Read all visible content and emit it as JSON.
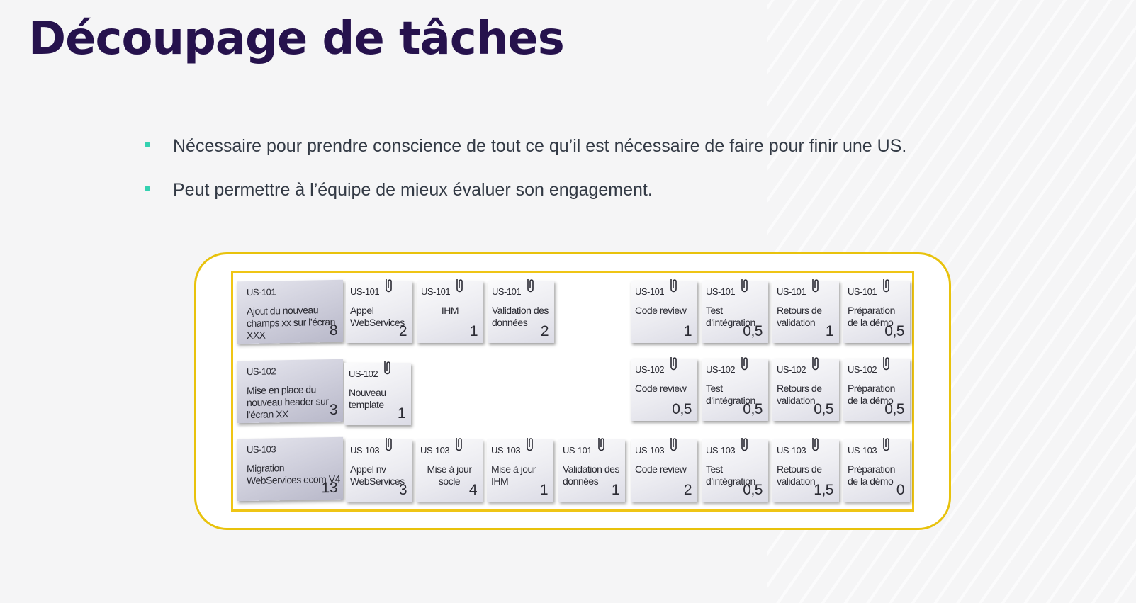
{
  "title": "Découpage de tâches",
  "bullets": [
    "Nécessaire pour prendre conscience de tout ce qu’il est nécessaire de  faire pour finir une US.",
    "Peut permettre à l’équipe de mieux évaluer son engagement."
  ],
  "board": {
    "rows": [
      {
        "story": {
          "id": "US-101",
          "text": "Ajout du nouveau champs xx sur l’écran XXX",
          "points": "8"
        },
        "tasks": [
          {
            "id": "US-101",
            "text": "Appel WebServices",
            "value": "2"
          },
          {
            "id": "US-101",
            "text": "IHM",
            "value": "1"
          },
          {
            "id": "US-101",
            "text": "Validation des données",
            "value": "2"
          },
          {
            "id": "US-101",
            "text": "Code review",
            "value": "1"
          },
          {
            "id": "US-101",
            "text": "Test d’intégration",
            "value": "0,5"
          },
          {
            "id": "US-101",
            "text": "Retours de validation",
            "value": "1"
          },
          {
            "id": "US-101",
            "text": "Préparation de la démo",
            "value": "0,5"
          }
        ]
      },
      {
        "story": {
          "id": "US-102",
          "text": "Mise en place du nouveau header sur l’écran XX",
          "points": "3"
        },
        "tasks": [
          {
            "id": "US-102",
            "text": "Nouveau template",
            "value": "1"
          },
          {
            "id": "US-102",
            "text": "Code review",
            "value": "0,5"
          },
          {
            "id": "US-102",
            "text": "Test d’intégration",
            "value": "0,5"
          },
          {
            "id": "US-102",
            "text": "Retours de validation",
            "value": "0,5"
          },
          {
            "id": "US-102",
            "text": "Préparation de la démo",
            "value": "0,5"
          }
        ]
      },
      {
        "story": {
          "id": "US-103",
          "text": "Migration WebServices ecom V4",
          "points": "13"
        },
        "tasks": [
          {
            "id": "US-103",
            "text": "Appel nv WebServices",
            "value": "3"
          },
          {
            "id": "US-103",
            "text": "Mise à jour socle",
            "value": "4"
          },
          {
            "id": "US-103",
            "text": "Mise à jour IHM",
            "value": "1"
          },
          {
            "id": "US-101",
            "text": "Validation des données",
            "value": "1"
          },
          {
            "id": "US-103",
            "text": "Code review",
            "value": "2"
          },
          {
            "id": "US-103",
            "text": "Test d’intégration",
            "value": "0,5"
          },
          {
            "id": "US-103",
            "text": "Retours de validation",
            "value": "1,5"
          },
          {
            "id": "US-103",
            "text": "Préparation de la démo",
            "value": "0"
          }
        ]
      }
    ]
  }
}
